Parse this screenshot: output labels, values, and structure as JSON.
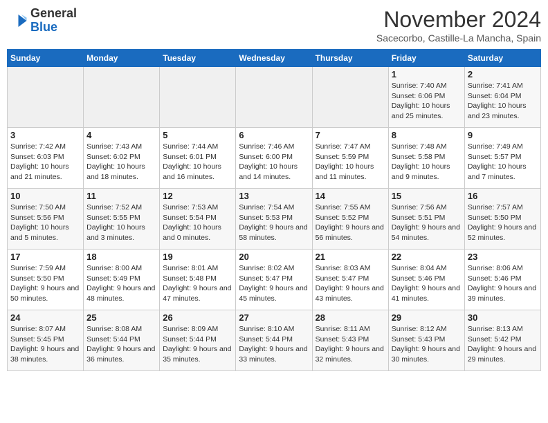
{
  "header": {
    "logo_general": "General",
    "logo_blue": "Blue",
    "month_title": "November 2024",
    "subtitle": "Sacecorbo, Castille-La Mancha, Spain"
  },
  "weekdays": [
    "Sunday",
    "Monday",
    "Tuesday",
    "Wednesday",
    "Thursday",
    "Friday",
    "Saturday"
  ],
  "weeks": [
    [
      {
        "day": "",
        "info": ""
      },
      {
        "day": "",
        "info": ""
      },
      {
        "day": "",
        "info": ""
      },
      {
        "day": "",
        "info": ""
      },
      {
        "day": "",
        "info": ""
      },
      {
        "day": "1",
        "info": "Sunrise: 7:40 AM\nSunset: 6:06 PM\nDaylight: 10 hours and 25 minutes."
      },
      {
        "day": "2",
        "info": "Sunrise: 7:41 AM\nSunset: 6:04 PM\nDaylight: 10 hours and 23 minutes."
      }
    ],
    [
      {
        "day": "3",
        "info": "Sunrise: 7:42 AM\nSunset: 6:03 PM\nDaylight: 10 hours and 21 minutes."
      },
      {
        "day": "4",
        "info": "Sunrise: 7:43 AM\nSunset: 6:02 PM\nDaylight: 10 hours and 18 minutes."
      },
      {
        "day": "5",
        "info": "Sunrise: 7:44 AM\nSunset: 6:01 PM\nDaylight: 10 hours and 16 minutes."
      },
      {
        "day": "6",
        "info": "Sunrise: 7:46 AM\nSunset: 6:00 PM\nDaylight: 10 hours and 14 minutes."
      },
      {
        "day": "7",
        "info": "Sunrise: 7:47 AM\nSunset: 5:59 PM\nDaylight: 10 hours and 11 minutes."
      },
      {
        "day": "8",
        "info": "Sunrise: 7:48 AM\nSunset: 5:58 PM\nDaylight: 10 hours and 9 minutes."
      },
      {
        "day": "9",
        "info": "Sunrise: 7:49 AM\nSunset: 5:57 PM\nDaylight: 10 hours and 7 minutes."
      }
    ],
    [
      {
        "day": "10",
        "info": "Sunrise: 7:50 AM\nSunset: 5:56 PM\nDaylight: 10 hours and 5 minutes."
      },
      {
        "day": "11",
        "info": "Sunrise: 7:52 AM\nSunset: 5:55 PM\nDaylight: 10 hours and 3 minutes."
      },
      {
        "day": "12",
        "info": "Sunrise: 7:53 AM\nSunset: 5:54 PM\nDaylight: 10 hours and 0 minutes."
      },
      {
        "day": "13",
        "info": "Sunrise: 7:54 AM\nSunset: 5:53 PM\nDaylight: 9 hours and 58 minutes."
      },
      {
        "day": "14",
        "info": "Sunrise: 7:55 AM\nSunset: 5:52 PM\nDaylight: 9 hours and 56 minutes."
      },
      {
        "day": "15",
        "info": "Sunrise: 7:56 AM\nSunset: 5:51 PM\nDaylight: 9 hours and 54 minutes."
      },
      {
        "day": "16",
        "info": "Sunrise: 7:57 AM\nSunset: 5:50 PM\nDaylight: 9 hours and 52 minutes."
      }
    ],
    [
      {
        "day": "17",
        "info": "Sunrise: 7:59 AM\nSunset: 5:50 PM\nDaylight: 9 hours and 50 minutes."
      },
      {
        "day": "18",
        "info": "Sunrise: 8:00 AM\nSunset: 5:49 PM\nDaylight: 9 hours and 48 minutes."
      },
      {
        "day": "19",
        "info": "Sunrise: 8:01 AM\nSunset: 5:48 PM\nDaylight: 9 hours and 47 minutes."
      },
      {
        "day": "20",
        "info": "Sunrise: 8:02 AM\nSunset: 5:47 PM\nDaylight: 9 hours and 45 minutes."
      },
      {
        "day": "21",
        "info": "Sunrise: 8:03 AM\nSunset: 5:47 PM\nDaylight: 9 hours and 43 minutes."
      },
      {
        "day": "22",
        "info": "Sunrise: 8:04 AM\nSunset: 5:46 PM\nDaylight: 9 hours and 41 minutes."
      },
      {
        "day": "23",
        "info": "Sunrise: 8:06 AM\nSunset: 5:46 PM\nDaylight: 9 hours and 39 minutes."
      }
    ],
    [
      {
        "day": "24",
        "info": "Sunrise: 8:07 AM\nSunset: 5:45 PM\nDaylight: 9 hours and 38 minutes."
      },
      {
        "day": "25",
        "info": "Sunrise: 8:08 AM\nSunset: 5:44 PM\nDaylight: 9 hours and 36 minutes."
      },
      {
        "day": "26",
        "info": "Sunrise: 8:09 AM\nSunset: 5:44 PM\nDaylight: 9 hours and 35 minutes."
      },
      {
        "day": "27",
        "info": "Sunrise: 8:10 AM\nSunset: 5:44 PM\nDaylight: 9 hours and 33 minutes."
      },
      {
        "day": "28",
        "info": "Sunrise: 8:11 AM\nSunset: 5:43 PM\nDaylight: 9 hours and 32 minutes."
      },
      {
        "day": "29",
        "info": "Sunrise: 8:12 AM\nSunset: 5:43 PM\nDaylight: 9 hours and 30 minutes."
      },
      {
        "day": "30",
        "info": "Sunrise: 8:13 AM\nSunset: 5:42 PM\nDaylight: 9 hours and 29 minutes."
      }
    ]
  ]
}
